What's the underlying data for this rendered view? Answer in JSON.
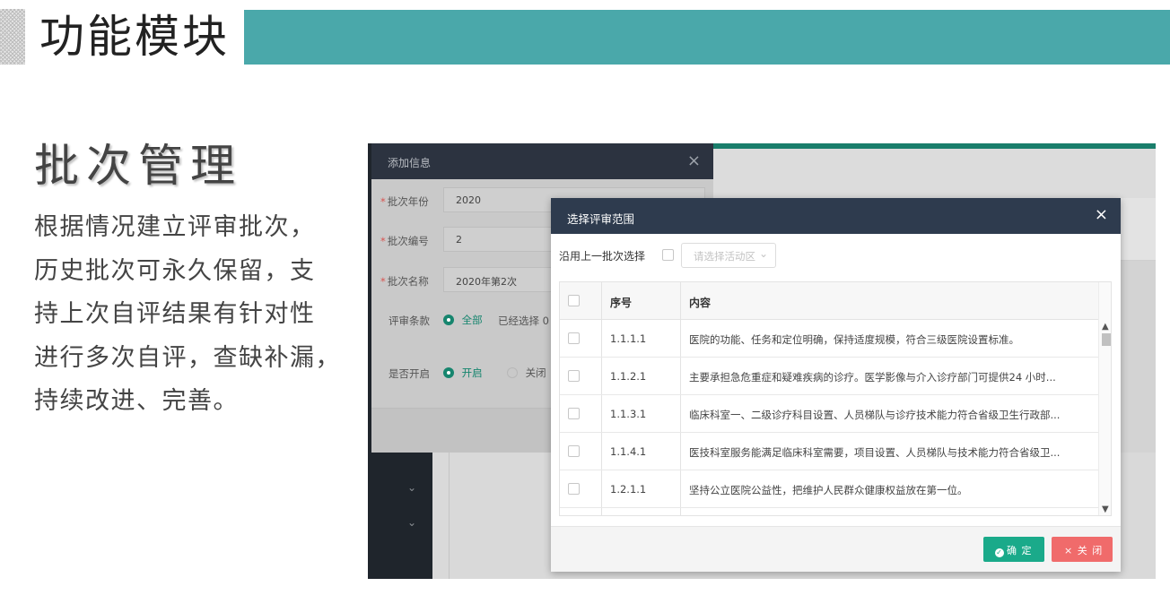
{
  "slide": {
    "title": "功能模块",
    "section_title": "批次管理",
    "description_lines": [
      "根据情况建立评审批次，",
      "历史批次可永久保留，支",
      "持上次自评结果有针对性",
      "进行多次自评，查缺补漏，",
      "持续改进、完善。"
    ],
    "accent_color": "#4aa8aa"
  },
  "add_dialog": {
    "title": "添加信息",
    "close_icon": "×",
    "fields": [
      {
        "label": "批次年份",
        "value": "2020",
        "required": true
      },
      {
        "label": "批次编号",
        "value": "2",
        "required": true
      },
      {
        "label": "批次名称",
        "value": "2020年第2次",
        "required": true
      }
    ],
    "review_items": {
      "label": "评审条款",
      "option_all": "全部",
      "selected_prefix": "已经选择 0"
    },
    "enabled": {
      "label": "是否开启",
      "option_on": "开启",
      "option_off": "关闭"
    }
  },
  "scope_dialog": {
    "title": "选择评审范围",
    "close_icon": "×",
    "reuse_label": "沿用上一批次选择",
    "activity_placeholder": "请选择活动区",
    "columns": {
      "no": "序号",
      "content": "内容"
    },
    "rows": [
      {
        "no": "1.1.1.1",
        "content": "医院的功能、任务和定位明确，保持适度规模，符合三级医院设置标准。"
      },
      {
        "no": "1.1.2.1",
        "content": "主要承担急危重症和疑难疾病的诊疗。医学影像与介入诊疗部门可提供24 小时..."
      },
      {
        "no": "1.1.3.1",
        "content": "临床科室一、二级诊疗科目设置、人员梯队与诊疗技术能力符合省级卫生行政部..."
      },
      {
        "no": "1.1.4.1",
        "content": "医技科室服务能满足临床科室需要，项目设置、人员梯队与技术能力符合省级卫..."
      },
      {
        "no": "1.2.1.1",
        "content": "坚持公立医院公益性，把维护人民群众健康权益放在第一位。"
      }
    ],
    "confirm_label": "确 定",
    "close_label": "× 关 闭",
    "confirm_color": "#1aaa8a",
    "close_color": "#f06b6b"
  }
}
